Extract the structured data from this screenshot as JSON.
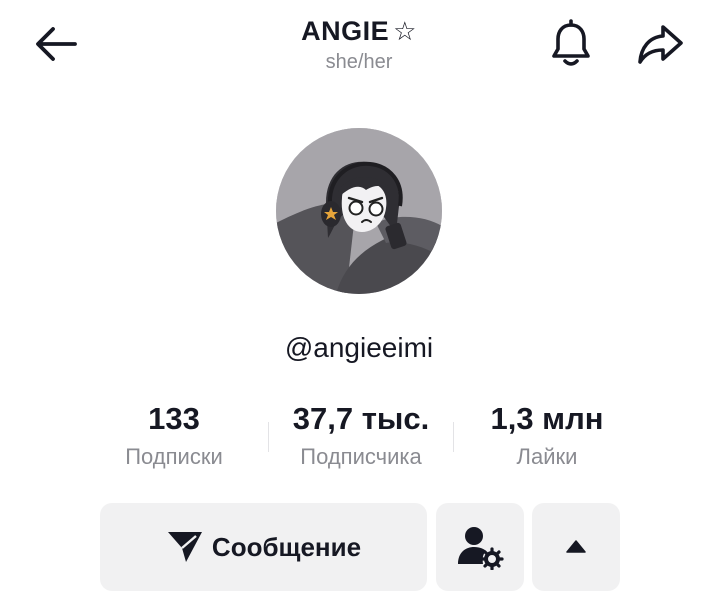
{
  "header": {
    "title": "ANGIE",
    "title_symbol": "☆",
    "pronouns": "she/her",
    "back_icon": "arrow-left-icon",
    "bell_icon": "bell-icon",
    "share_icon": "share-arrow-icon"
  },
  "profile": {
    "avatar_icon": "avatar-image",
    "username": "@angieeimi"
  },
  "stats": [
    {
      "value": "133",
      "label": "Подписки"
    },
    {
      "value": "37,7 тыс.",
      "label": "Подписчика"
    },
    {
      "value": "1,3 млн",
      "label": "Лайки"
    }
  ],
  "actions": {
    "message_label": "Сообщение",
    "message_icon": "send-icon",
    "friend_settings_icon": "user-gear-icon",
    "more_icon": "triangle-up-icon"
  },
  "colors": {
    "text": "#161823",
    "secondary_text": "#8a8b91",
    "button_bg": "#f1f1f2"
  }
}
